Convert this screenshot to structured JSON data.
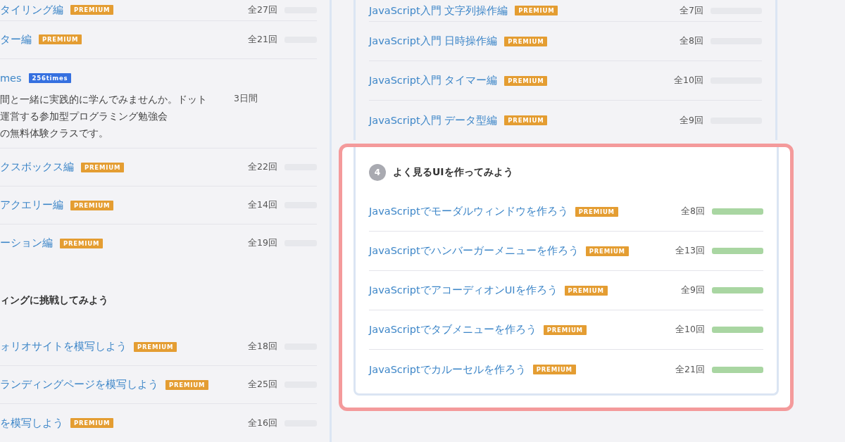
{
  "left_column": {
    "items": [
      {
        "kind": "lesson",
        "title": "タイリング編",
        "badge": "PREMIUM",
        "count": "全27回",
        "level": 0
      },
      {
        "kind": "lesson",
        "title": "ター編",
        "badge": "PREMIUM",
        "count": "全21回",
        "level": 0
      },
      {
        "kind": "event",
        "title": "mes",
        "badge": "256times",
        "description_lines": [
          "間と一緒に実践的に学んでみませんか。ドット",
          "運営する参加型プログラミング勉強会",
          "の無料体験クラスです。"
        ],
        "duration": "3日間"
      },
      {
        "kind": "lesson",
        "title": "クスボックス編",
        "badge": "PREMIUM",
        "count": "全22回",
        "level": 0
      },
      {
        "kind": "lesson",
        "title": "アクエリー編",
        "badge": "PREMIUM",
        "count": "全14回",
        "level": 0
      },
      {
        "kind": "lesson",
        "title": "ーション編",
        "badge": "PREMIUM",
        "count": "全19回",
        "level": 0
      },
      {
        "kind": "heading",
        "title": "ィングに挑戦してみよう"
      },
      {
        "kind": "lesson",
        "title": "ォリオサイトを模写しよう",
        "badge": "PREMIUM",
        "count": "全18回",
        "level": 0
      },
      {
        "kind": "lesson",
        "title": "ランディングページを模写しよう",
        "badge": "PREMIUM",
        "count": "全25回",
        "level": 0
      },
      {
        "kind": "lesson",
        "title": "を模写しよう",
        "badge": "PREMIUM",
        "count": "全16回",
        "level": 0
      }
    ]
  },
  "right_column": {
    "lessons": [
      {
        "title": "JavaScript入門 文字列操作編",
        "badge": "PREMIUM",
        "count": "全7回",
        "level": 0
      },
      {
        "title": "JavaScript入門 日時操作編",
        "badge": "PREMIUM",
        "count": "全8回",
        "level": 0
      },
      {
        "title": "JavaScript入門 タイマー編",
        "badge": "PREMIUM",
        "count": "全10回",
        "level": 0
      },
      {
        "title": "JavaScript入門 データ型編",
        "badge": "PREMIUM",
        "count": "全9回",
        "level": 0
      }
    ],
    "section": {
      "number": "4",
      "title": "よく見るUIを作ってみよう",
      "highlighted": true,
      "lessons": [
        {
          "title": "JavaScriptでモーダルウィンドウを作ろう",
          "badge": "PREMIUM",
          "count": "全8回",
          "level": 1
        },
        {
          "title": "JavaScriptでハンバーガーメニューを作ろう",
          "badge": "PREMIUM",
          "count": "全13回",
          "level": 1
        },
        {
          "title": "JavaScriptでアコーディオンUIを作ろう",
          "badge": "PREMIUM",
          "count": "全9回",
          "level": 1
        },
        {
          "title": "JavaScriptでタブメニューを作ろう",
          "badge": "PREMIUM",
          "count": "全10回",
          "level": 1
        },
        {
          "title": "JavaScriptでカルーセルを作ろう",
          "badge": "PREMIUM",
          "count": "全21回",
          "level": 1
        }
      ]
    }
  }
}
